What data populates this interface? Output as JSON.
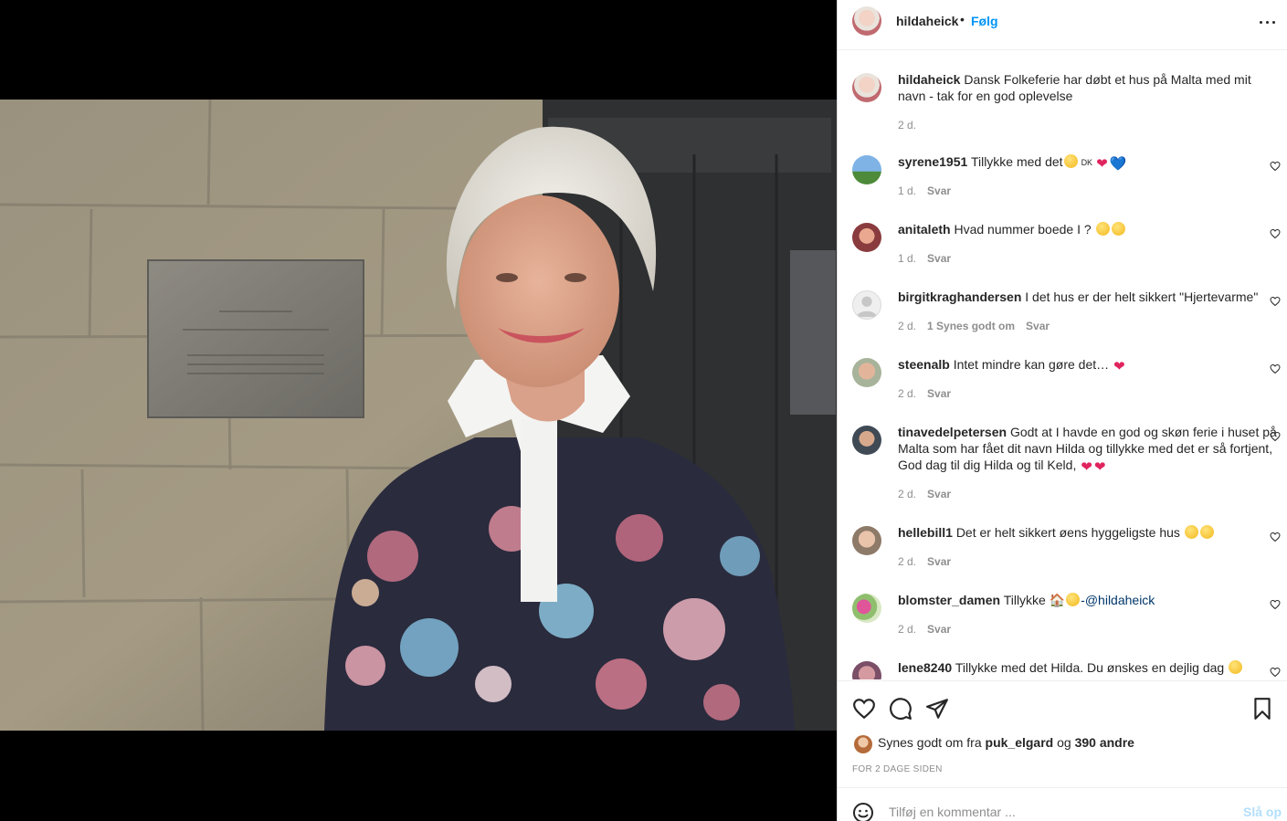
{
  "header": {
    "username": "hildaheick",
    "separator": "•",
    "follow_label": "Følg",
    "more_icon": "more-horizontal-icon"
  },
  "caption": {
    "username": "hildaheick",
    "text": "Dansk Folkeferie har døbt et hus på Malta med mit navn - tak for en god oplevelse",
    "time": "2 d."
  },
  "comments": [
    {
      "username": "syrene1951",
      "text": "Tillykke med det",
      "emoji_suffix": [
        "👏",
        "DK",
        "❤",
        "💙"
      ],
      "time": "1 d.",
      "reply": "Svar"
    },
    {
      "username": "anitaleth",
      "text": "Hvad nummer boede I ?",
      "emoji_suffix": [
        "😋",
        "😋"
      ],
      "time": "1 d.",
      "reply": "Svar"
    },
    {
      "username": "birgitkraghandersen",
      "text": "I det hus er der helt sikkert \"Hjertevarme\"",
      "time": "2 d.",
      "likes": "1 Synes godt om",
      "reply": "Svar"
    },
    {
      "username": "steenalb",
      "text": "Intet mindre kan gøre det…",
      "emoji_suffix": [
        "❤"
      ],
      "time": "2 d.",
      "reply": "Svar"
    },
    {
      "username": "tinavedelpetersen",
      "text": "Godt at I havde en god og skøn ferie i huset på Malta som har fået dit navn Hilda og tillykke med det er så fortjent, God dag til dig Hilda og til Keld,",
      "emoji_suffix": [
        "❤",
        "❤"
      ],
      "time": "2 d.",
      "reply": "Svar"
    },
    {
      "username": "hellebill1",
      "text": "Det er helt sikkert øens hyggeligste hus",
      "emoji_suffix": [
        "🤩",
        "🤗"
      ],
      "time": "2 d.",
      "reply": "Svar"
    },
    {
      "username": "blomster_damen",
      "text": "Tillykke",
      "emoji_suffix": [
        "🏠",
        "🌼"
      ],
      "mention": "-@hildaheick",
      "time": "2 d.",
      "reply": "Svar"
    },
    {
      "username": "lene8240",
      "text": "Tillykke med det Hilda. Du ønskes en dejlig dag",
      "emoji_suffix": [
        "🌼"
      ]
    }
  ],
  "actions": {
    "like_icon": "heart-icon",
    "comment_icon": "comment-icon",
    "share_icon": "send-icon",
    "save_icon": "bookmark-icon"
  },
  "likes": {
    "prefix": "Synes godt om fra",
    "user": "puk_elgard",
    "joiner": "og",
    "others": "390 andre"
  },
  "timestamp": "FOR 2 DAGE SIDEN",
  "add_comment": {
    "placeholder": "Tilføj en kommentar ...",
    "post_label": "Slå op"
  },
  "colors": {
    "accent": "#0095f6",
    "text": "#262626",
    "muted": "#8e8e8e",
    "post_disabled": "#b2dffc"
  }
}
